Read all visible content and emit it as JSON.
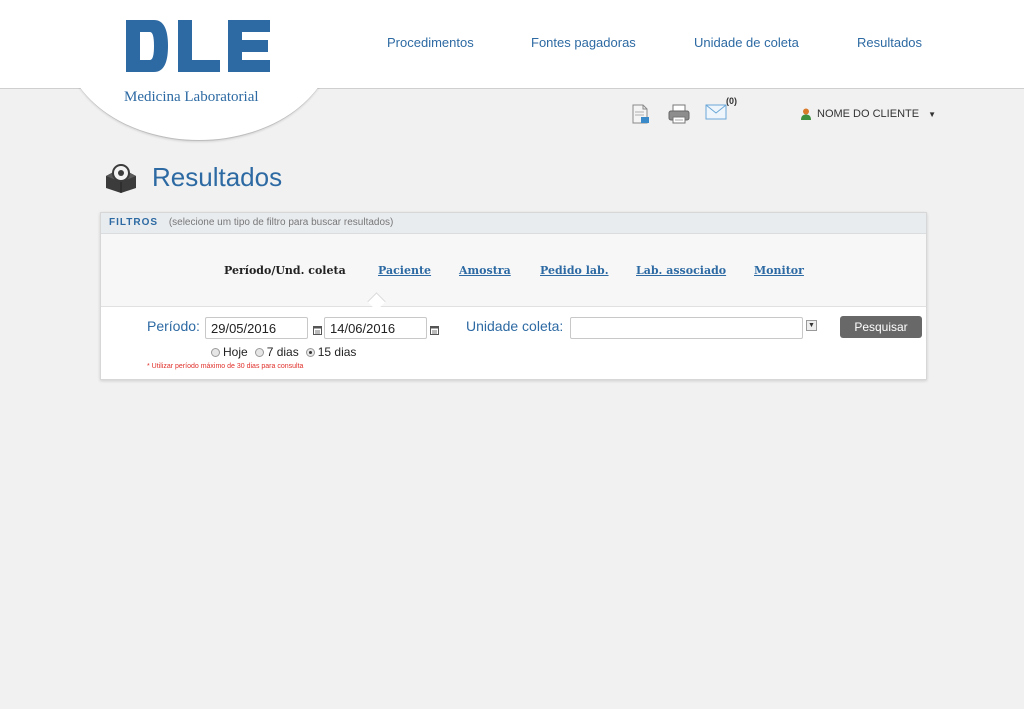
{
  "logo": {
    "mark": "DLE",
    "subtitle": "Medicina Laboratorial",
    "color": "#2d6aa3"
  },
  "nav": {
    "items": [
      {
        "label": "Procedimentos"
      },
      {
        "label": "Fontes pagadoras"
      },
      {
        "label": "Unidade de coleta"
      },
      {
        "label": "Resultados"
      }
    ]
  },
  "toolbar": {
    "icons": [
      "document-icon",
      "printer-icon",
      "envelope-icon"
    ],
    "mail_count": "(0)"
  },
  "user": {
    "name": "NOME DO CLIENTE"
  },
  "page": {
    "title": "Resultados"
  },
  "filters": {
    "header_label": "FILTROS",
    "header_hint": "(selecione um tipo de filtro para buscar resultados)",
    "tabs": [
      {
        "label": "Período/Und. coleta",
        "active": true
      },
      {
        "label": "Paciente"
      },
      {
        "label": "Amostra"
      },
      {
        "label": "Pedido lab."
      },
      {
        "label": "Lab. associado"
      },
      {
        "label": "Monitor"
      }
    ],
    "periodo_label": "Período:",
    "date_from": "29/05/2016",
    "date_to": "14/06/2016",
    "unidade_label": "Unidade coleta:",
    "unidade_value": "",
    "radios": [
      {
        "label": "Hoje",
        "checked": false
      },
      {
        "label": "7 dias",
        "checked": false
      },
      {
        "label": "15 dias",
        "checked": true
      }
    ],
    "note": "* Utilizar período máximo de 30 dias para consulta",
    "search_button": "Pesquisar"
  },
  "colors": {
    "accent": "#2d6aa3",
    "warning": "#e0302a",
    "button": "#686868"
  }
}
